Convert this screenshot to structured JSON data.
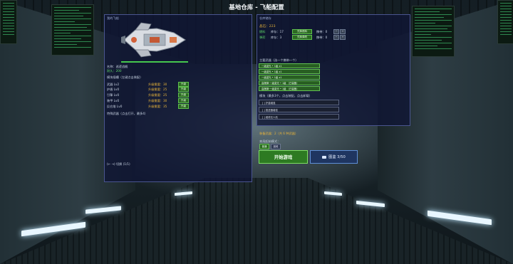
{
  "title": "基地仓库 - 飞船配置",
  "ship_panel": {
    "header": "我的飞船",
    "name_label": "名称：巡逻战舰",
    "hp_label": "耐久：200",
    "slots_title": "模块插槽（左键点击装配）",
    "slots": [
      {
        "name": "武器 Lv2",
        "req": "升级需要：30",
        "btn": "升级"
      },
      {
        "name": "护盾 Lv0",
        "req": "升级需要：25",
        "btn": "升级"
      },
      {
        "name": "引擎 Lv0",
        "req": "升级需要：25",
        "btn": "升级"
      },
      {
        "name": "装甲 Lv0",
        "req": "升级需要：30",
        "btn": "升级"
      },
      {
        "name": "反应堆 Lv0",
        "req": "升级需要：35",
        "btn": "升级"
      }
    ],
    "special_note": "特殊武器（点击打开，最多4）",
    "page_info": "(← →) 切换 (1/1)"
  },
  "storage_panel": {
    "header": "仓库储存",
    "crystal_label": "晶石：223",
    "materials": [
      {
        "name": "燃料",
        "have": "库存：17",
        "btn": "兑换燃料",
        "count": "携带：0"
      },
      {
        "name": "弹药",
        "have": "库存：3",
        "btn": "兑换弹药",
        "count": "携带：0"
      }
    ],
    "weapons_title": "主要武器（选一个携带一个）",
    "weapons": [
      "一级激光 • 1级 x1",
      "一级激光 • 1级 x1",
      "一级激光 • 1级 x1",
      "高爆弹·一级激光 • 1级 （已装备）",
      "高爆弹·一级激光 • 1级 （已装备）"
    ],
    "modules_title": "模块（最多3个，点击装配，点击卸载）",
    "modules": [
      "[ ] 护盾增强",
      "[ ] 推进器增强",
      "[ ] 维修无人机"
    ],
    "selected_info": "装备武器：2（共 6 种武器）",
    "mode_title": "本局起始模式：",
    "mode_options": [
      "普通",
      "困难"
    ],
    "start_btn": "开始游戏",
    "archive_btn": "图鉴 3/50"
  }
}
